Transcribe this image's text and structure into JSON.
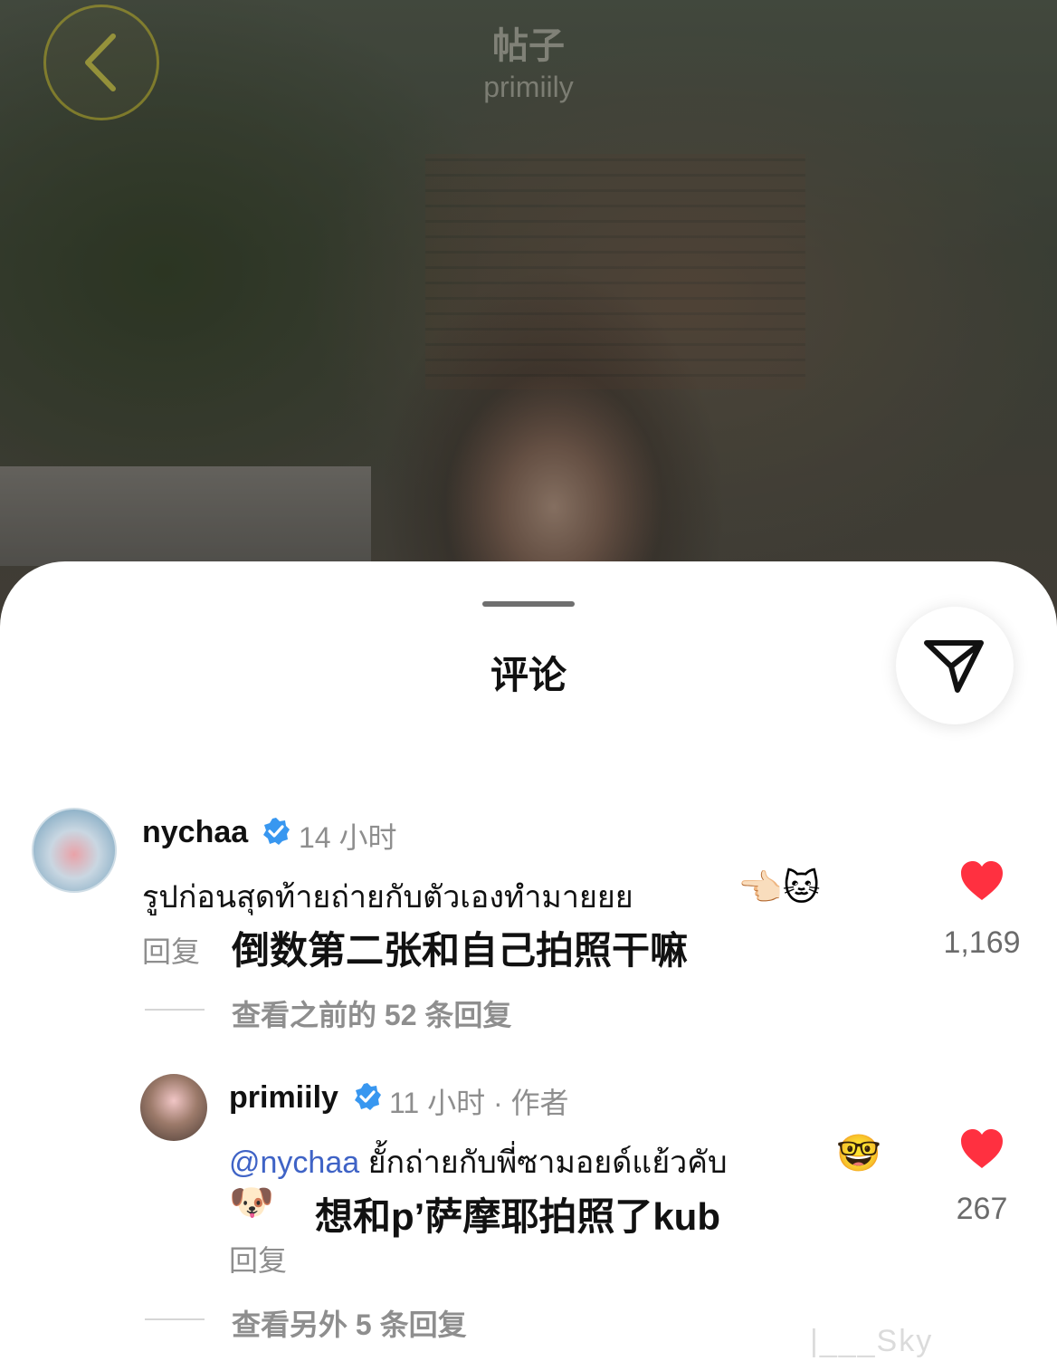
{
  "header": {
    "title": "帖子",
    "subtitle": "primiily"
  },
  "sheet": {
    "title": "评论"
  },
  "comments": [
    {
      "username": "nychaa",
      "time": "14 小时",
      "text": "รูปก่อนสุดท้ายถ่ายกับตัวเองทำมายยย",
      "emojis": "👈🏻🐱",
      "translation": "倒数第二张和自己拍照干嘛",
      "reply_label": "回复",
      "likes": "1,169",
      "view_replies": "查看之前的 52 条回复"
    },
    {
      "username": "primiily",
      "time": "11 小时 · 作者",
      "mention": "@nychaa",
      "text": " ยั้กถ่ายกับพี่ซามอยด์แย้วคับ",
      "emoji_end": "🤓",
      "emoji_start": "🐶",
      "translation": "想和p’萨摩耶拍照了kub",
      "reply_label": "回复",
      "likes": "267",
      "view_replies": "查看另外 5 条回复"
    }
  ],
  "watermark": "|___Sky",
  "colors": {
    "like": "#ff3040",
    "verified": "#3897f0",
    "mention": "#3f63c6"
  },
  "icons": [
    "back-arrow-icon",
    "send-icon",
    "verified-badge-icon",
    "heart-icon"
  ]
}
